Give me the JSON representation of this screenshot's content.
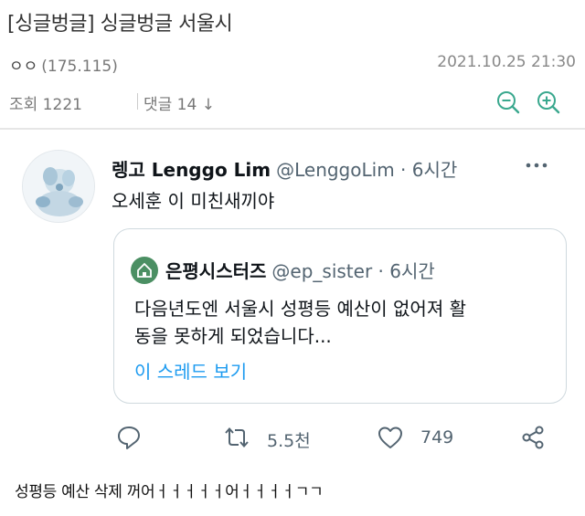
{
  "post": {
    "title": "[싱글벙글] 싱글벙글 서울시",
    "author_nick": "ㅇㅇ",
    "author_ip": "(175.115)",
    "date": "2021.10.25 21:30",
    "views_label": "조회 1221",
    "comments_label": "댓글 14",
    "comments_arrow": "↓"
  },
  "tweet": {
    "name": "렝고 Lenggo Lim",
    "handle": "@LenggoLim · 6시간",
    "text": "오세훈 이 미친새끼야",
    "quote": {
      "name": "은평시스터즈",
      "handle": "@ep_sister · 6시간",
      "line1": "다음년도엔 서울시 성평등 예산이 없어져  활",
      "line2": "동을 못하게 되었습니다...",
      "thread_link": "이 스레드 보기"
    },
    "actions": {
      "retweets": "5.5천",
      "likes": "749"
    }
  },
  "comment": {
    "text": "성평등 예산 삭제 꺼어ㅓㅓㅓㅓㅓ어ㅓㅓㅓㅓㄱㄱ"
  },
  "colors": {
    "link_blue": "#1d9bf0",
    "zoom_green": "#3aa88e",
    "muted": "#536471"
  }
}
